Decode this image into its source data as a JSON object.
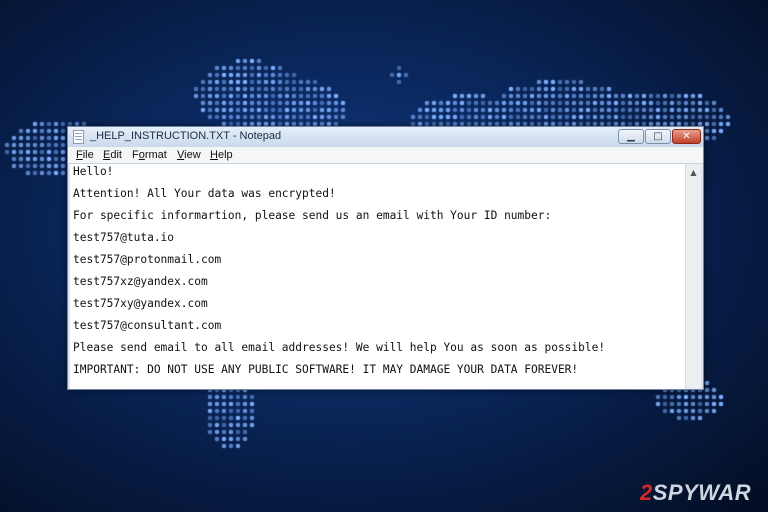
{
  "window": {
    "title": "_HELP_INSTRUCTION.TXT - Notepad",
    "controls": {
      "minimize": "▁",
      "maximize": "□",
      "close": "✕"
    }
  },
  "menu": [
    {
      "label": "File",
      "accel": "F",
      "rest": "ile"
    },
    {
      "label": "Edit",
      "accel": "E",
      "rest": "dit"
    },
    {
      "label": "Format",
      "accel": "o",
      "pre": "F",
      "rest": "rmat"
    },
    {
      "label": "View",
      "accel": "V",
      "rest": "iew"
    },
    {
      "label": "Help",
      "accel": "H",
      "rest": "elp"
    }
  ],
  "document": {
    "lines": [
      "Hello!",
      "Attention! All Your data was encrypted!",
      "For specific informartion, please send us an email with Your ID number:",
      "test757@tuta.io",
      "test757@protonmail.com",
      "test757xz@yandex.com",
      "test757xy@yandex.com",
      "test757@consultant.com",
      "Please send email to all email addresses! We will help You as soon as possible!",
      "IMPORTANT: DO NOT USE ANY PUBLIC SOFTWARE! IT MAY DAMAGE YOUR DATA FOREVER!"
    ]
  },
  "watermark": {
    "prefix": "2",
    "text": "SPYWAR"
  },
  "colors": {
    "background": "#0b2a63",
    "map_dots": "#7fb0ff",
    "close_button": "#c2412a"
  }
}
